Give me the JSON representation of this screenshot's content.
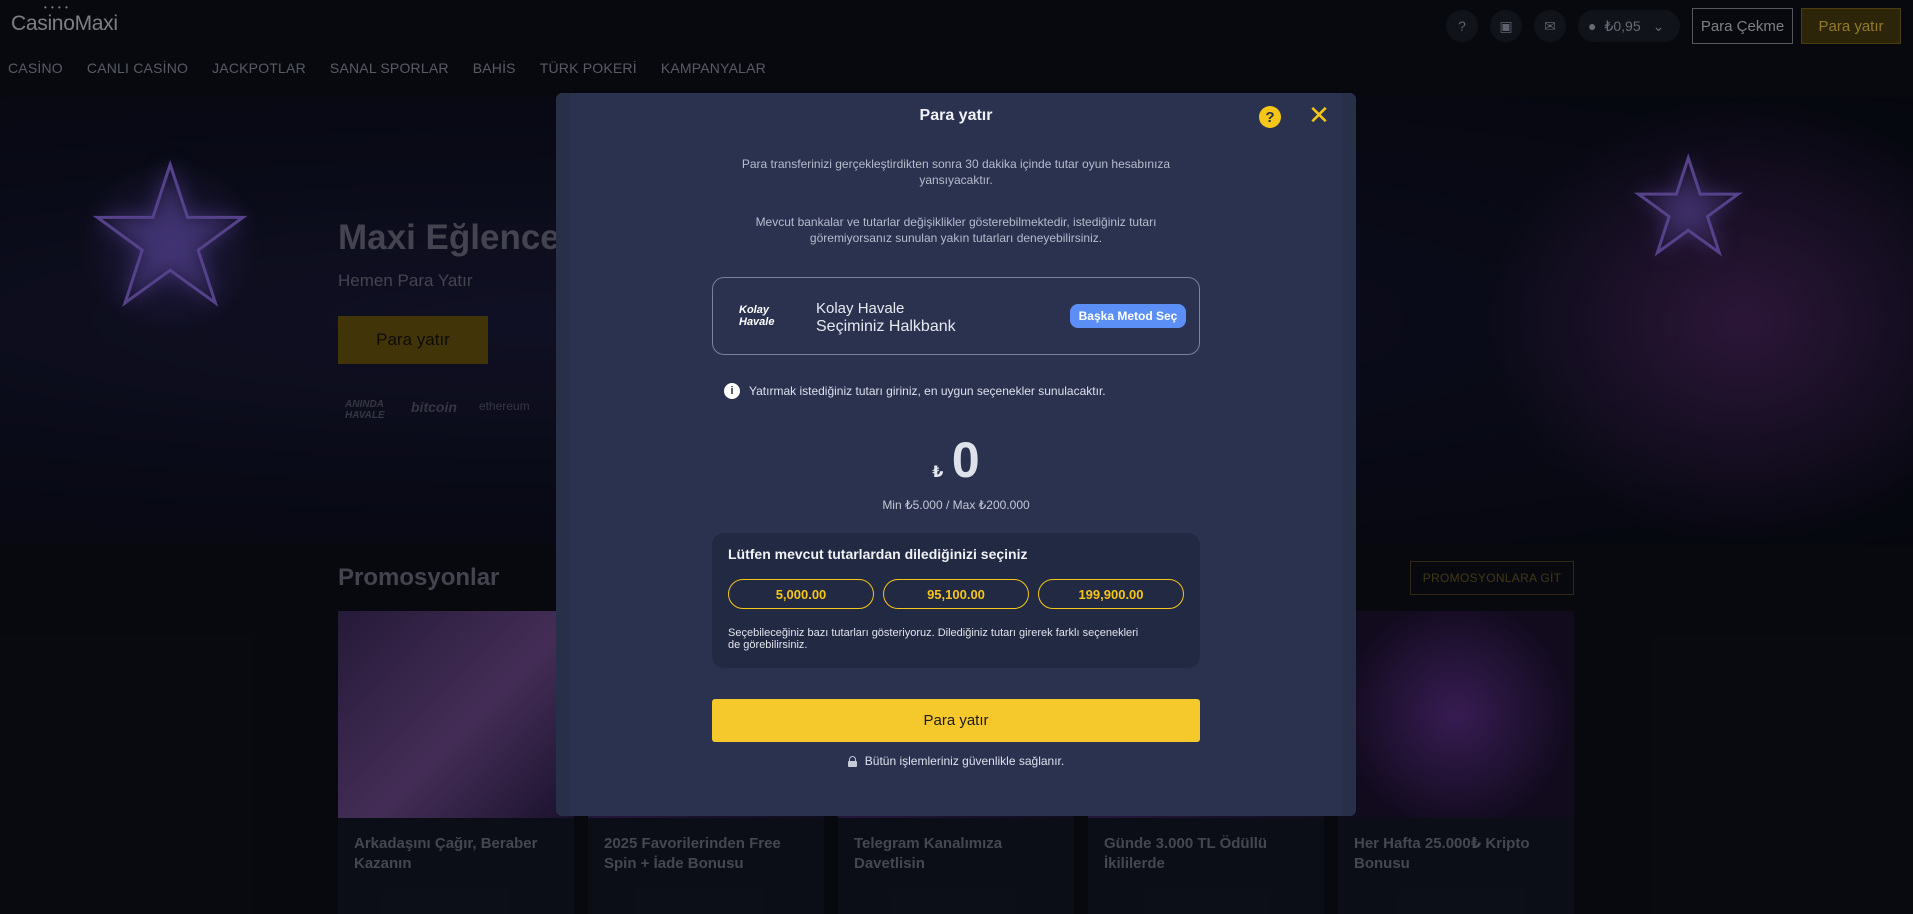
{
  "header": {
    "logo": "CasinoMaxi",
    "balance": "₺0,95",
    "withdraw_label": "Para Çekme",
    "deposit_label": "Para yatır",
    "icons": [
      "help-icon",
      "gift-icon",
      "mail-icon",
      "user-icon",
      "chevron-down-icon"
    ]
  },
  "nav": {
    "items": [
      "CASİNO",
      "CANLI CASİNO",
      "JACKPOTLAR",
      "SANAL SPORLAR",
      "BAHİS",
      "TÜRK POKERİ",
      "KAMPANYALAR"
    ]
  },
  "hero": {
    "title": "Maxi Eğlencey",
    "subtitle": "Hemen Para Yatır",
    "button": "Para yatır",
    "payment_logos": [
      "ANINDA HAVALE",
      "bitcoin",
      "ethereum"
    ]
  },
  "promo": {
    "title": "Promosyonlar",
    "link": "PROMOSYONLARA GİT",
    "cards": [
      {
        "label": "Arkadaşını Çağır, Beraber Kazanın"
      },
      {
        "label": "2025 Favorilerinden Free Spin + İade Bonusu"
      },
      {
        "label": "Telegram Kanalımıza Davetlisin"
      },
      {
        "label": "Günde 3.000 TL Ödüllü İkililerde"
      },
      {
        "label": "Her Hafta 25.000₺ Kripto Bonusu"
      }
    ]
  },
  "modal": {
    "title": "Para yatır",
    "note1": "Para transferinizi gerçekleştirdikten sonra 30 dakika içinde tutar oyun hesabınıza yansıyacaktır.",
    "note2": "Mevcut bankalar ve tutarlar değişiklikler gösterebilmektedir, istediğiniz tutarı göremiyorsanız sunulan yakın tutarları deneyebilirsiniz.",
    "method": {
      "logo_line1": "Kolay",
      "logo_line2": "Havale",
      "name": "Kolay Havale",
      "selection": "Seçiminiz Halkbank",
      "change_label": "Başka Metod Seç"
    },
    "info": "Yatırmak istediğiniz tutarı giriniz, en uygun seçenekler sunulacaktır.",
    "amount": {
      "currency": "₺",
      "value": "0",
      "limits": "Min ₺5.000 / Max ₺200.000"
    },
    "choose": {
      "title": "Lütfen mevcut tutarlardan dilediğinizi seçiniz",
      "options": [
        "5,000.00",
        "95,100.00",
        "199,900.00"
      ],
      "note": "Seçebileceğiniz bazı tutarları gösteriyoruz. Dilediğiniz tutarı girerek farklı seçenekleri de görebilirsiniz."
    },
    "submit_label": "Para yatır",
    "secure_note": "Bütün işlemleriniz güvenlikle sağlanır."
  },
  "colors": {
    "accent": "#f5c518",
    "modal_bg": "#2a3250",
    "method_button": "#5b8ff5",
    "page_bg": "#0d1019"
  }
}
